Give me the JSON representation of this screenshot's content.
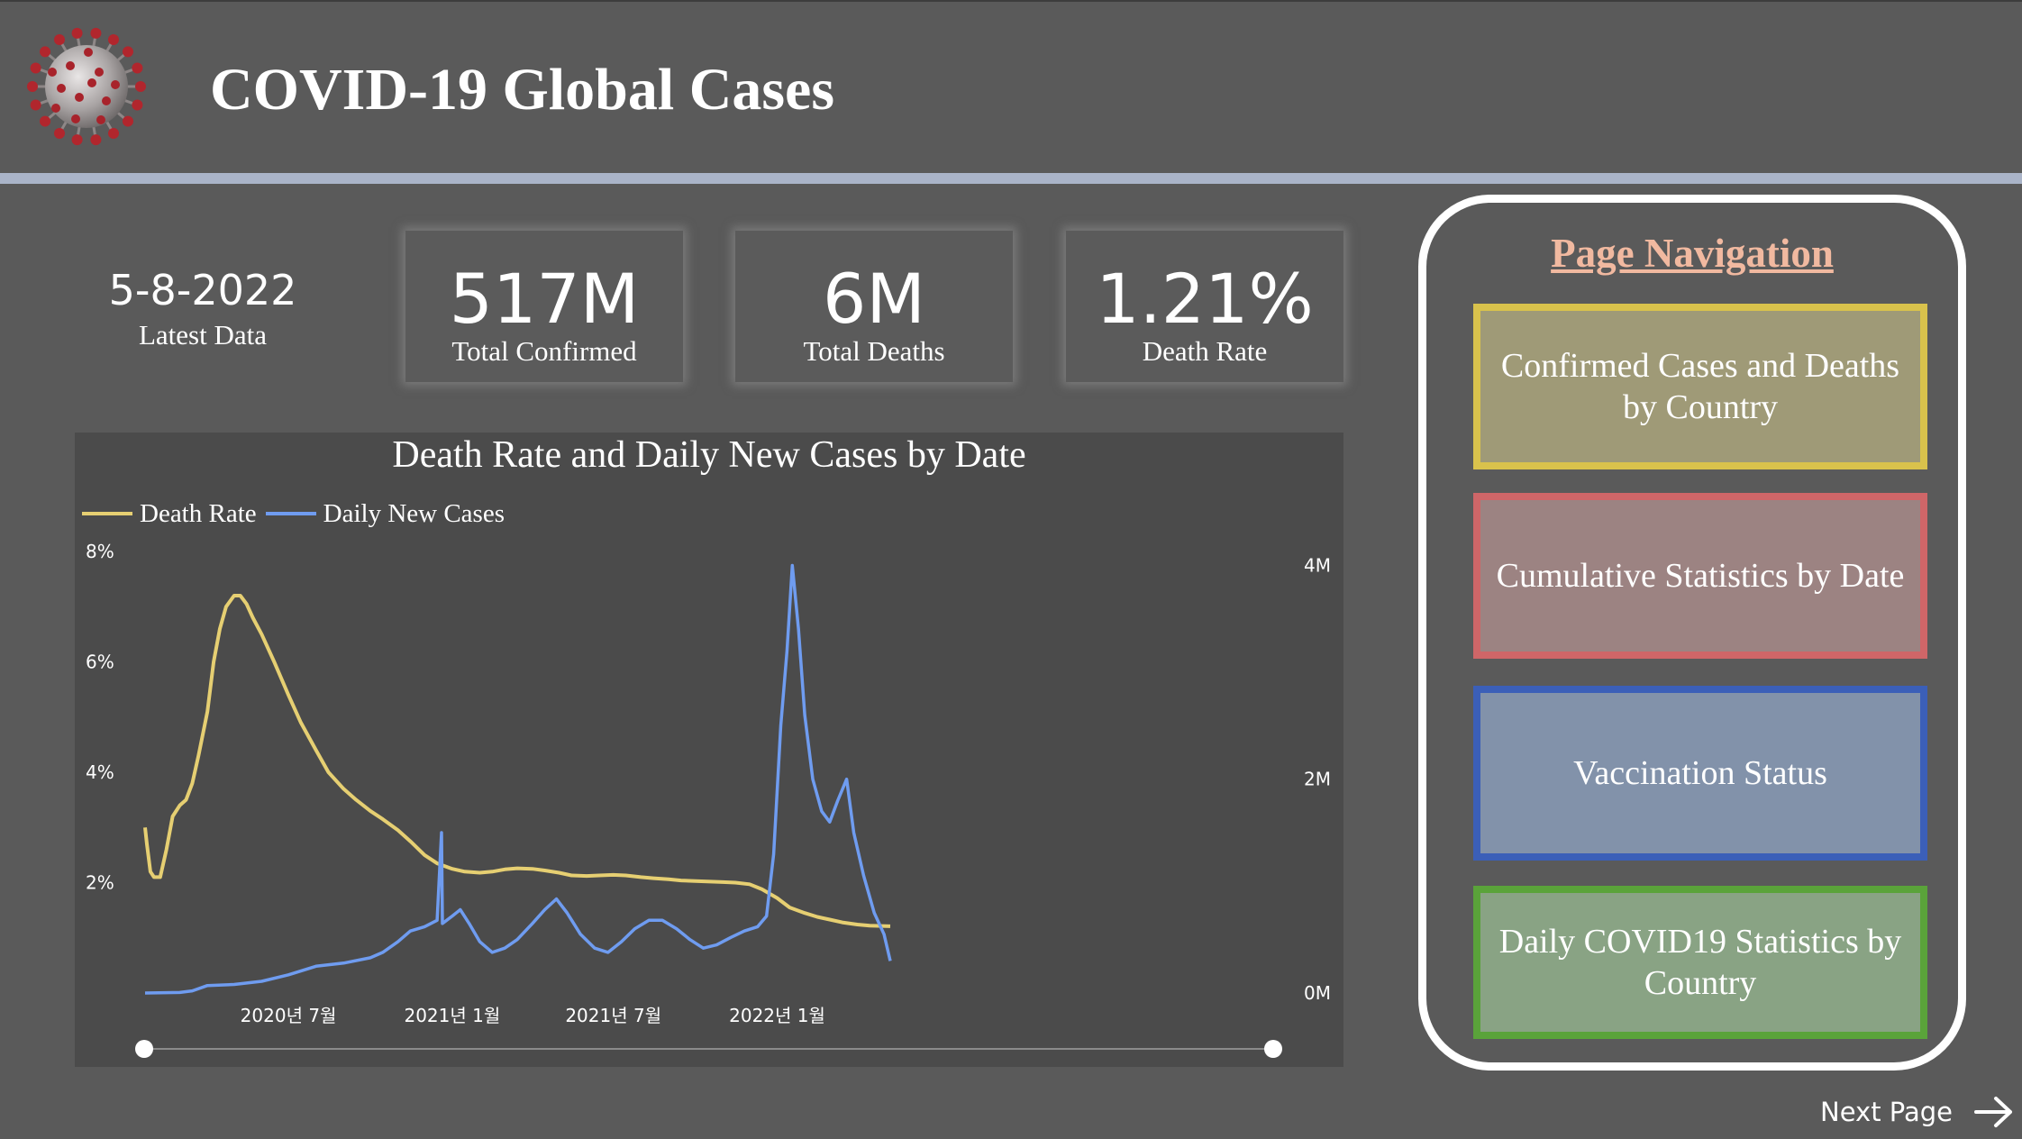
{
  "header": {
    "title": "COVID-19 Global Cases",
    "logo_icon": "coronavirus-icon"
  },
  "date_block": {
    "date": "5-8-2022",
    "label": "Latest Data"
  },
  "kpis": [
    {
      "value": "517M",
      "label": "Total Confirmed"
    },
    {
      "value": "6M",
      "label": "Total Deaths"
    },
    {
      "value": "1.21%",
      "label": "Death Rate"
    }
  ],
  "chart": {
    "title": "Death Rate and Daily New Cases by Date",
    "legend": [
      "Death Rate",
      "Daily New Cases"
    ]
  },
  "chart_data": {
    "type": "line",
    "title": "Death Rate and Daily New Cases by Date",
    "x_tick_labels": [
      "2020년 7월",
      "2021년 1월",
      "2021년 7월",
      "2022년 1월"
    ],
    "x_range": [
      "2020-01-22",
      "2022-05-08"
    ],
    "y_left": {
      "ticks": [
        "2%",
        "4%",
        "6%",
        "8%"
      ],
      "range": [
        0,
        8
      ]
    },
    "y_right": {
      "ticks": [
        "0M",
        "2M",
        "4M"
      ],
      "range": [
        0,
        4.4
      ]
    },
    "colors": {
      "death_rate": "#e6cf72",
      "daily_new_cases": "#6f9cf0"
    },
    "legend_placement": "top-left",
    "series": [
      {
        "name": "Death Rate",
        "axis": "left",
        "points": [
          [
            "2020-01-22",
            3.0
          ],
          [
            "2020-01-24",
            2.7
          ],
          [
            "2020-01-28",
            2.2
          ],
          [
            "2020-02-01",
            2.1
          ],
          [
            "2020-02-08",
            2.1
          ],
          [
            "2020-02-15",
            2.6
          ],
          [
            "2020-02-22",
            3.2
          ],
          [
            "2020-03-01",
            3.4
          ],
          [
            "2020-03-08",
            3.5
          ],
          [
            "2020-03-15",
            3.8
          ],
          [
            "2020-03-22",
            4.3
          ],
          [
            "2020-04-01",
            5.1
          ],
          [
            "2020-04-08",
            6.0
          ],
          [
            "2020-04-15",
            6.6
          ],
          [
            "2020-04-22",
            7.0
          ],
          [
            "2020-05-01",
            7.2
          ],
          [
            "2020-05-08",
            7.2
          ],
          [
            "2020-05-15",
            7.05
          ],
          [
            "2020-05-22",
            6.8
          ],
          [
            "2020-06-01",
            6.5
          ],
          [
            "2020-06-15",
            6.0
          ],
          [
            "2020-07-01",
            5.4
          ],
          [
            "2020-07-15",
            4.9
          ],
          [
            "2020-08-01",
            4.4
          ],
          [
            "2020-08-15",
            4.0
          ],
          [
            "2020-09-01",
            3.7
          ],
          [
            "2020-09-15",
            3.5
          ],
          [
            "2020-10-01",
            3.3
          ],
          [
            "2020-10-15",
            3.15
          ],
          [
            "2020-11-01",
            2.95
          ],
          [
            "2020-11-15",
            2.75
          ],
          [
            "2020-12-01",
            2.5
          ],
          [
            "2020-12-15",
            2.35
          ],
          [
            "2021-01-01",
            2.25
          ],
          [
            "2021-01-15",
            2.2
          ],
          [
            "2021-02-01",
            2.18
          ],
          [
            "2021-02-15",
            2.2
          ],
          [
            "2021-03-01",
            2.24
          ],
          [
            "2021-03-15",
            2.26
          ],
          [
            "2021-04-01",
            2.25
          ],
          [
            "2021-04-15",
            2.22
          ],
          [
            "2021-05-01",
            2.18
          ],
          [
            "2021-05-15",
            2.13
          ],
          [
            "2021-06-01",
            2.12
          ],
          [
            "2021-06-15",
            2.13
          ],
          [
            "2021-07-01",
            2.14
          ],
          [
            "2021-07-15",
            2.13
          ],
          [
            "2021-08-01",
            2.1
          ],
          [
            "2021-08-15",
            2.08
          ],
          [
            "2021-09-01",
            2.06
          ],
          [
            "2021-09-15",
            2.04
          ],
          [
            "2021-10-01",
            2.03
          ],
          [
            "2021-10-15",
            2.02
          ],
          [
            "2021-11-01",
            2.01
          ],
          [
            "2021-11-15",
            2.0
          ],
          [
            "2021-12-01",
            1.97
          ],
          [
            "2021-12-15",
            1.88
          ],
          [
            "2022-01-01",
            1.72
          ],
          [
            "2022-01-15",
            1.55
          ],
          [
            "2022-02-01",
            1.45
          ],
          [
            "2022-02-15",
            1.38
          ],
          [
            "2022-03-01",
            1.33
          ],
          [
            "2022-03-15",
            1.28
          ],
          [
            "2022-04-01",
            1.24
          ],
          [
            "2022-04-15",
            1.22
          ],
          [
            "2022-05-08",
            1.21
          ]
        ]
      },
      {
        "name": "Daily New Cases",
        "axis": "right",
        "unit": "M",
        "points": [
          [
            "2020-01-22",
            0.0
          ],
          [
            "2020-03-01",
            0.005
          ],
          [
            "2020-03-15",
            0.02
          ],
          [
            "2020-04-01",
            0.07
          ],
          [
            "2020-05-01",
            0.08
          ],
          [
            "2020-06-01",
            0.11
          ],
          [
            "2020-07-01",
            0.17
          ],
          [
            "2020-08-01",
            0.25
          ],
          [
            "2020-09-01",
            0.28
          ],
          [
            "2020-10-01",
            0.33
          ],
          [
            "2020-10-15",
            0.38
          ],
          [
            "2020-11-01",
            0.48
          ],
          [
            "2020-11-15",
            0.58
          ],
          [
            "2020-12-01",
            0.62
          ],
          [
            "2020-12-15",
            0.68
          ],
          [
            "2020-12-20",
            1.5
          ],
          [
            "2020-12-21",
            0.65
          ],
          [
            "2021-01-01",
            0.72
          ],
          [
            "2021-01-10",
            0.78
          ],
          [
            "2021-01-20",
            0.65
          ],
          [
            "2021-02-01",
            0.48
          ],
          [
            "2021-02-15",
            0.38
          ],
          [
            "2021-03-01",
            0.42
          ],
          [
            "2021-03-15",
            0.5
          ],
          [
            "2021-04-01",
            0.65
          ],
          [
            "2021-04-15",
            0.78
          ],
          [
            "2021-04-28",
            0.88
          ],
          [
            "2021-05-10",
            0.75
          ],
          [
            "2021-05-25",
            0.55
          ],
          [
            "2021-06-10",
            0.42
          ],
          [
            "2021-06-25",
            0.38
          ],
          [
            "2021-07-10",
            0.48
          ],
          [
            "2021-07-25",
            0.6
          ],
          [
            "2021-08-10",
            0.68
          ],
          [
            "2021-08-25",
            0.68
          ],
          [
            "2021-09-10",
            0.6
          ],
          [
            "2021-09-25",
            0.5
          ],
          [
            "2021-10-10",
            0.42
          ],
          [
            "2021-10-25",
            0.45
          ],
          [
            "2021-11-10",
            0.52
          ],
          [
            "2021-11-25",
            0.58
          ],
          [
            "2021-12-10",
            0.62
          ],
          [
            "2021-12-20",
            0.72
          ],
          [
            "2021-12-28",
            1.3
          ],
          [
            "2022-01-05",
            2.5
          ],
          [
            "2022-01-12",
            3.2
          ],
          [
            "2022-01-18",
            4.0
          ],
          [
            "2022-01-25",
            3.4
          ],
          [
            "2022-02-01",
            2.6
          ],
          [
            "2022-02-10",
            2.0
          ],
          [
            "2022-02-20",
            1.7
          ],
          [
            "2022-03-01",
            1.6
          ],
          [
            "2022-03-10",
            1.8
          ],
          [
            "2022-03-20",
            2.0
          ],
          [
            "2022-03-28",
            1.5
          ],
          [
            "2022-04-08",
            1.1
          ],
          [
            "2022-04-20",
            0.75
          ],
          [
            "2022-05-01",
            0.55
          ],
          [
            "2022-05-08",
            0.3
          ]
        ]
      }
    ]
  },
  "navigation": {
    "title": "Page Navigation",
    "items": [
      {
        "label": "Confirmed Cases and Deaths by Country",
        "bg": "#9f9a77",
        "border": "#d9c24c"
      },
      {
        "label": "Cumulative Statistics by Date",
        "bg": "#9c8382",
        "border": "#cf6668"
      },
      {
        "label": "Vaccination Status",
        "bg": "#8292aa",
        "border": "#3b5fb8"
      },
      {
        "label": "Daily COVID19 Statistics by Country",
        "bg": "#89a384",
        "border": "#5aa33a"
      }
    ]
  },
  "next_page": {
    "label": "Next Page",
    "icon": "arrow-right-icon"
  }
}
